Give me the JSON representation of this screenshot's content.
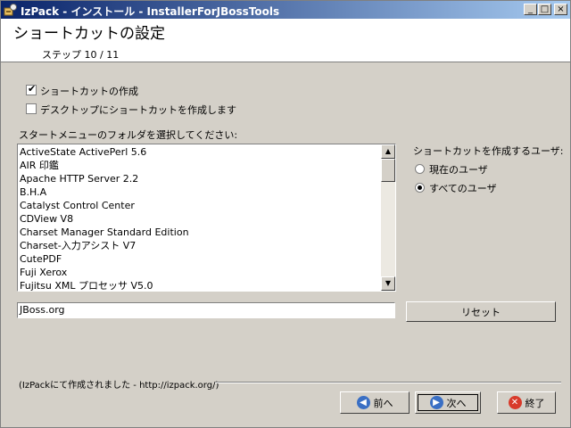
{
  "window": {
    "title": "IzPack - インストール - InstallerForJBossTools",
    "controls": {
      "minimize": "_",
      "maximize": "□",
      "close": "×"
    }
  },
  "header": {
    "title": "ショートカットの設定",
    "step": "ステップ 10 / 11"
  },
  "options": {
    "create_shortcut": {
      "label": "ショートカットの作成",
      "checked": true
    },
    "desktop_shortcut": {
      "label": "デスクトップにショートカットを作成します",
      "checked": false
    }
  },
  "folder_list": {
    "label": "スタートメニューのフォルダを選択してください:",
    "items": [
      "ActiveState ActivePerl 5.6",
      "AIR 印鑑",
      "Apache HTTP Server 2.2",
      "B.H.A",
      "Catalyst Control Center",
      "CDView V8",
      "Charset Manager Standard Edition",
      "Charset-入力アシスト V7",
      "CutePDF",
      "Fuji Xerox",
      "Fujitsu XML プロセッサ V5.0"
    ]
  },
  "user_choice": {
    "label": "ショートカットを作成するユーザ:",
    "options": [
      {
        "label": "現在のユーザ",
        "selected": false
      },
      {
        "label": "すべてのユーザ",
        "selected": true
      }
    ]
  },
  "folder_input": {
    "value": "JBoss.org"
  },
  "reset_button": {
    "label": "リセット"
  },
  "footer": {
    "credit": "(IzPackにて作成されました - http://izpack.org/)",
    "prev_label": "前へ",
    "next_label": "次へ",
    "quit_label": "終了"
  },
  "colors": {
    "titlebar_start": "#0a246a",
    "titlebar_end": "#a6caf0",
    "prev_icon": "#3a6fc4",
    "next_icon": "#3a6fc4",
    "quit_icon": "#d83a2a"
  },
  "icons": {
    "app": "izpack-app-icon",
    "prev": "arrow-left-icon",
    "next": "arrow-right-icon",
    "quit": "close-icon"
  }
}
